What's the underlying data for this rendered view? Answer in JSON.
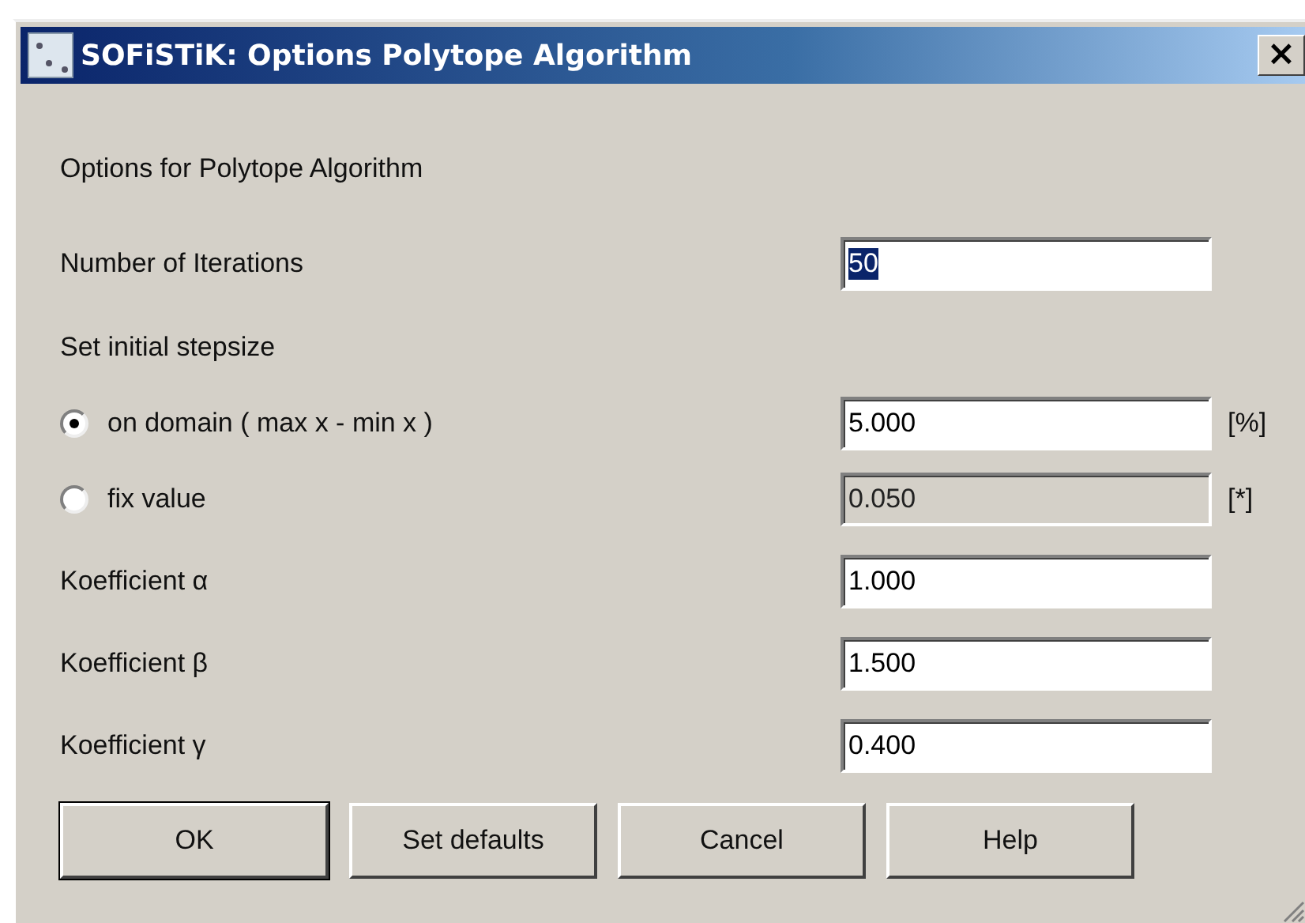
{
  "window": {
    "title": "SOFiSTiK: Options Polytope Algorithm",
    "close": "×"
  },
  "heading": "Options for Polytope Algorithm",
  "iterations": {
    "label": "Number of Iterations",
    "value": "50",
    "value_selected": true
  },
  "stepsize": {
    "label": "Set initial stepsize",
    "options": [
      {
        "label": "on domain ( max x - min x )",
        "selected": true,
        "value": "5.000",
        "unit": "[%]",
        "disabled": false
      },
      {
        "label": "fix value",
        "selected": false,
        "value": "0.050",
        "unit": "[*]",
        "disabled": true
      }
    ]
  },
  "coefficients": [
    {
      "label": "Koefficient α",
      "value": "1.000"
    },
    {
      "label": "Koefficient β",
      "value": "1.500"
    },
    {
      "label": "Koefficient γ",
      "value": "0.400"
    }
  ],
  "buttons": [
    {
      "label": "OK",
      "default": true
    },
    {
      "label": "Set defaults",
      "default": false
    },
    {
      "label": "Cancel",
      "default": false
    },
    {
      "label": "Help",
      "default": false
    }
  ]
}
